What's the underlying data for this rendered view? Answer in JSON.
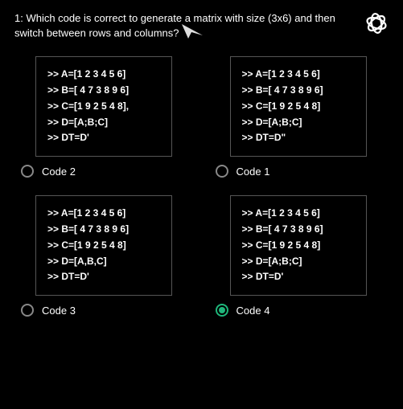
{
  "question": "1: Which code is correct to generate a matrix with size (3x6) and then switch between rows and columns?",
  "options": {
    "topLeft": {
      "label": "Code 2",
      "lines": [
        ">> A=[1 2 3 4 5 6]",
        ">> B=[ 4 7 3 8 9 6]",
        ">> C=[1 9 2 5 4 8],",
        ">> D=[A;B;C]",
        ">> DT=D'"
      ],
      "selected": false
    },
    "topRight": {
      "label": "Code 1",
      "lines": [
        ">> A=[1 2 3 4 5 6]",
        ">> B=[ 4 7 3 8 9 6]",
        ">> C=[1 9 2 5 4 8]",
        ">> D=[A;B;C]",
        ">> DT=D\""
      ],
      "selected": false
    },
    "bottomLeft": {
      "label": "Code 3",
      "lines": [
        ">> A=[1 2 3 4 5 6]",
        ">> B=[ 4 7 3 8 9 6]",
        ">> C=[1 9 2 5 4 8]",
        ">> D=[A,B,C]",
        ">> DT=D'"
      ],
      "selected": false
    },
    "bottomRight": {
      "label": "Code 4",
      "lines": [
        ">> A=[1 2 3 4 5 6]",
        ">> B=[ 4 7 3 8 9 6]",
        ">> C=[1 9 2 5 4 8]",
        ">> D=[A;B;C]",
        ">> DT=D'"
      ],
      "selected": true
    }
  }
}
